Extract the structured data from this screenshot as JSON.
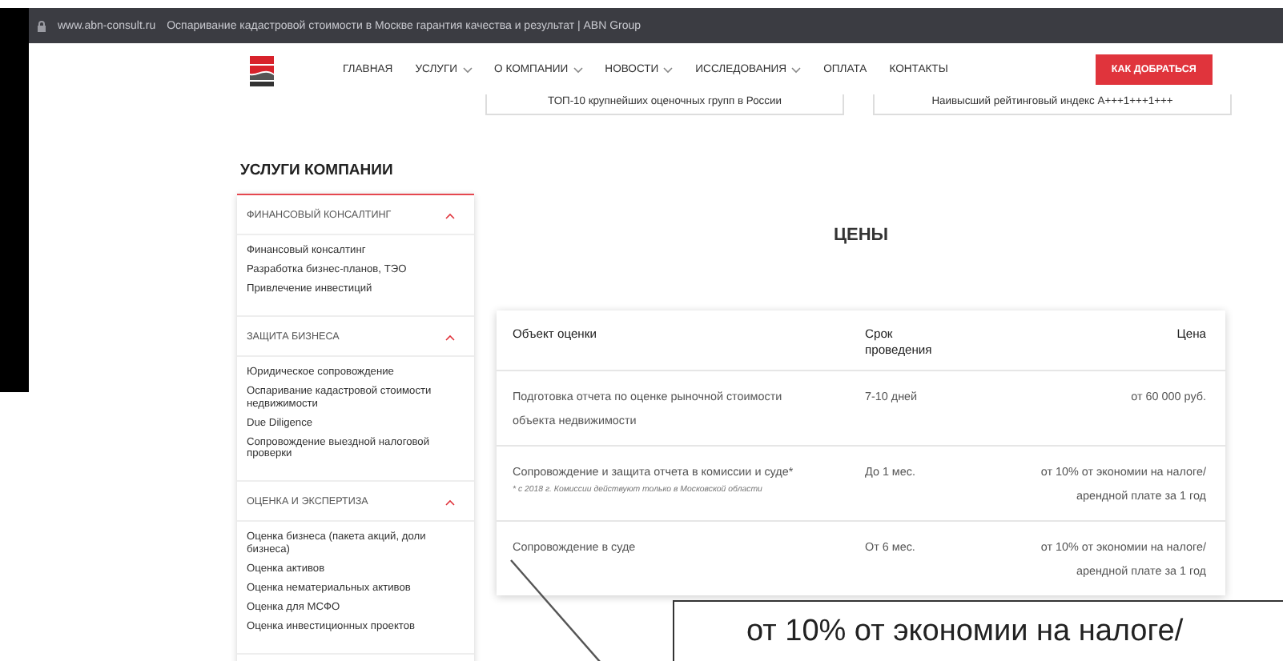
{
  "browser": {
    "url": "www.abn-consult.ru",
    "title": "Оспаривание кадастровой стоимости в Москве гарантия качества и результат | ABN Group"
  },
  "nav": {
    "items": [
      {
        "label": "ГЛАВНАЯ",
        "dropdown": false
      },
      {
        "label": "УСЛУГИ",
        "dropdown": true
      },
      {
        "label": "О КОМПАНИИ",
        "dropdown": true
      },
      {
        "label": "НОВОСТИ",
        "dropdown": true
      },
      {
        "label": "ИССЛЕДОВАНИЯ",
        "dropdown": true
      },
      {
        "label": "ОПЛАТА",
        "dropdown": false
      },
      {
        "label": "КОНТАКТЫ",
        "dropdown": false
      }
    ],
    "cta": "КАК ДОБРАТЬСЯ"
  },
  "highlights": [
    "ТОП-10 крупнейших оценочных групп в России",
    "Наивысший рейтинговый индекс A+++1+++1+++"
  ],
  "sidebar": {
    "title": "УСЛУГИ КОМПАНИИ",
    "sections": [
      {
        "label": "ФИНАНСОВЫЙ КОНСАЛТИНГ",
        "expanded": true,
        "items": [
          "Финансовый консалтинг",
          "Разработка бизнес-планов, ТЭО",
          "Привлечение инвестиций"
        ]
      },
      {
        "label": "ЗАЩИТА БИЗНЕСА",
        "expanded": true,
        "items": [
          "Юридическое сопровождение",
          "Оспаривание кадастровой стоимости недвижимости",
          "Due Diligence",
          "Сопровождение выездной налоговой проверки"
        ]
      },
      {
        "label": "ОЦЕНКА И ЭКСПЕРТИЗА",
        "expanded": true,
        "items": [
          "Оценка бизнеса (пакета акций, доли бизнеса)",
          "Оценка активов",
          "Оценка нематериальных активов",
          "Оценка для МСФО",
          "Оценка инвестиционных проектов"
        ]
      }
    ]
  },
  "prices": {
    "title": "ЦЕНЫ",
    "columns": [
      "Объект оценки",
      "Срок проведения",
      "Цена"
    ],
    "rows": [
      {
        "object": "Подготовка отчета по оценке рыночной стоимости объекта недвижимости",
        "term": "7-10 дней",
        "price": "от 60 000 руб."
      },
      {
        "object": "Сопровождение и защита отчета в комиссии и суде*",
        "note": "* с 2018 г. Комиссии действуют только в Московской области",
        "term": "До 1 мес.",
        "price": "от 10% от экономии на налоге/ арендной плате за 1 год"
      },
      {
        "object": "Сопровождение в суде",
        "term": "От 6 мес.",
        "price": "от 10% от экономии на налоге/ арендной плате за 1 год"
      }
    ]
  },
  "callout": {
    "text": "от 10% от экономии на налоге/"
  }
}
